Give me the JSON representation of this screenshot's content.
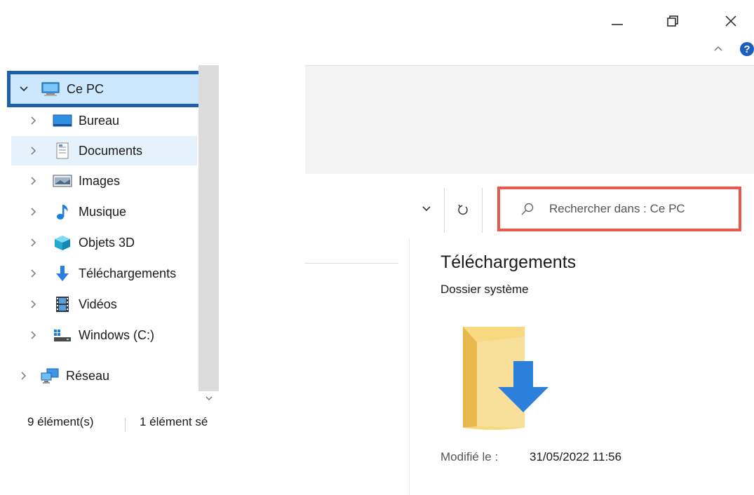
{
  "window": {
    "minimize_icon": "minimize-icon",
    "restore_icon": "restore-icon",
    "close_icon": "close-icon",
    "help_label": "?"
  },
  "address": {
    "dropdown_icon": "chevron-down-icon",
    "refresh_icon": "refresh-icon"
  },
  "search": {
    "placeholder": "Rechercher dans : Ce PC",
    "icon": "search-icon",
    "highlight_color": "#e8584f"
  },
  "nav": {
    "root": {
      "label": "Ce PC",
      "icon": "computer-icon",
      "highlight_color": "#1f5ea8"
    },
    "items": [
      {
        "label": "Bureau",
        "icon": "desktop-icon"
      },
      {
        "label": "Documents",
        "icon": "documents-icon"
      },
      {
        "label": "Images",
        "icon": "images-icon"
      },
      {
        "label": "Musique",
        "icon": "music-icon"
      },
      {
        "label": "Objets 3D",
        "icon": "objects3d-icon"
      },
      {
        "label": "Téléchargements",
        "icon": "downloads-icon"
      },
      {
        "label": "Vidéos",
        "icon": "videos-icon"
      },
      {
        "label": "Windows (C:)",
        "icon": "drive-icon"
      }
    ],
    "network": {
      "label": "Réseau",
      "icon": "network-icon"
    }
  },
  "status": {
    "count": "9 élément(s)",
    "selected": "1 élément sé"
  },
  "preview": {
    "title": "Téléchargements",
    "subtitle": "Dossier système",
    "modified_label": "Modifié le :",
    "modified_value": "31/05/2022 11:56"
  }
}
